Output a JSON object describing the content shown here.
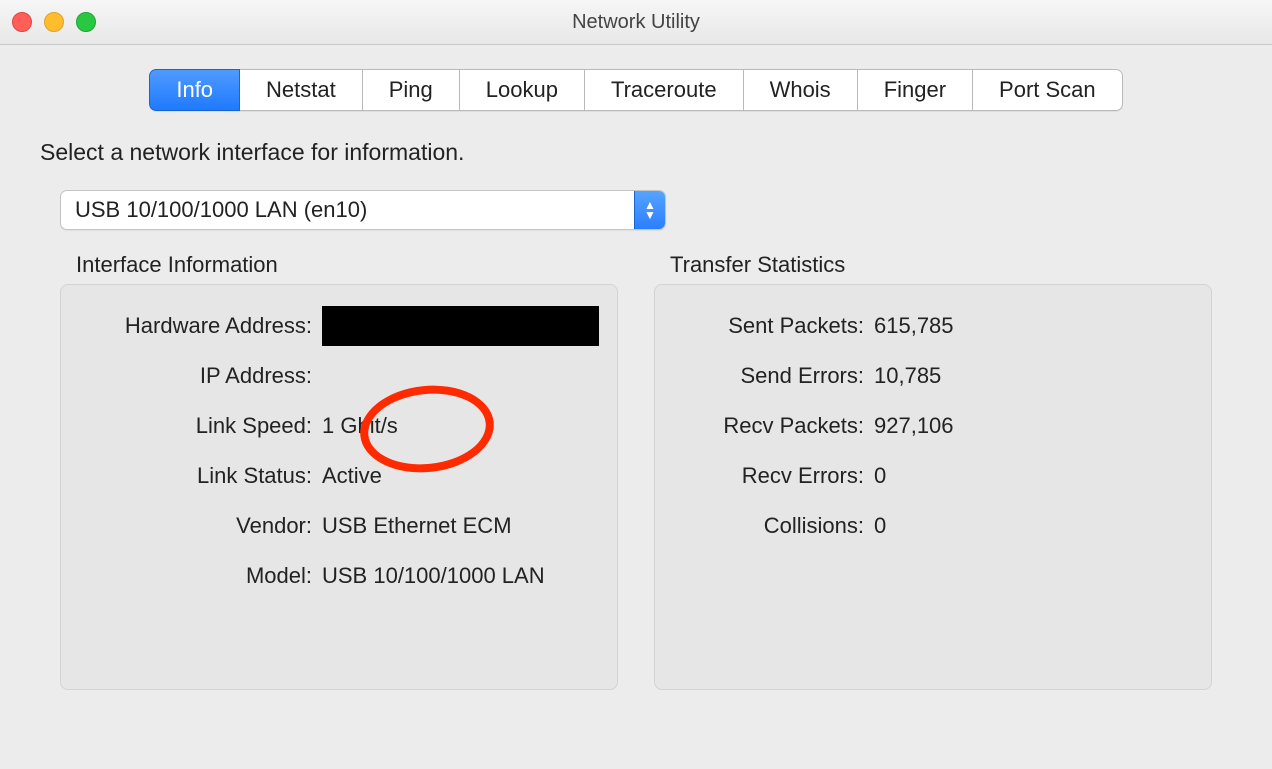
{
  "window": {
    "title": "Network Utility"
  },
  "tabs": [
    {
      "label": "Info",
      "active": true
    },
    {
      "label": "Netstat",
      "active": false
    },
    {
      "label": "Ping",
      "active": false
    },
    {
      "label": "Lookup",
      "active": false
    },
    {
      "label": "Traceroute",
      "active": false
    },
    {
      "label": "Whois",
      "active": false
    },
    {
      "label": "Finger",
      "active": false
    },
    {
      "label": "Port Scan",
      "active": false
    }
  ],
  "instruction": "Select a network interface for information.",
  "interface_select": {
    "value": "USB 10/100/1000 LAN (en10)"
  },
  "interface_info": {
    "heading": "Interface Information",
    "rows": {
      "hw_addr": {
        "label": "Hardware Address:",
        "value": "",
        "redacted": true
      },
      "ip_addr": {
        "label": "IP Address:",
        "value": ""
      },
      "speed": {
        "label": "Link Speed:",
        "value": "1 Gbit/s"
      },
      "status": {
        "label": "Link Status:",
        "value": "Active"
      },
      "vendor": {
        "label": "Vendor:",
        "value": "USB Ethernet ECM"
      },
      "model": {
        "label": "Model:",
        "value": "USB 10/100/1000 LAN"
      }
    }
  },
  "transfer_stats": {
    "heading": "Transfer Statistics",
    "rows": {
      "sent_packets": {
        "label": "Sent Packets:",
        "value": "615,785"
      },
      "send_errors": {
        "label": "Send Errors:",
        "value": "10,785"
      },
      "recv_packets": {
        "label": "Recv Packets:",
        "value": "927,106"
      },
      "recv_errors": {
        "label": "Recv Errors:",
        "value": "0"
      },
      "collisions": {
        "label": "Collisions:",
        "value": "0"
      }
    }
  }
}
